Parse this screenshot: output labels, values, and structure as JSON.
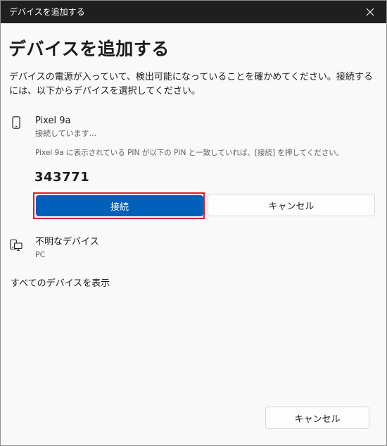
{
  "window": {
    "title": "デバイスを追加する"
  },
  "dialog": {
    "heading": "デバイスを追加する",
    "description": "デバイスの電源が入っていて、検出可能になっていることを確かめてください。接続するには、以下からデバイスを選択してください。"
  },
  "pairing_device": {
    "icon": "phone-icon",
    "name": "Pixel 9a",
    "status": "接続しています...",
    "pin_instruction": "Pixel 9a に表示されている PIN が以下の PIN と一致していれば、[接続] を押してください。",
    "pin": "343771",
    "connect_label": "接続",
    "cancel_label": "キャンセル",
    "accent_color": "#005fb8",
    "highlight_color": "#e01e2b"
  },
  "other_device": {
    "icon": "pc-icon",
    "name": "不明なデバイス",
    "type": "PC"
  },
  "show_all_label": "すべてのデバイスを表示",
  "footer": {
    "cancel_label": "キャンセル"
  }
}
